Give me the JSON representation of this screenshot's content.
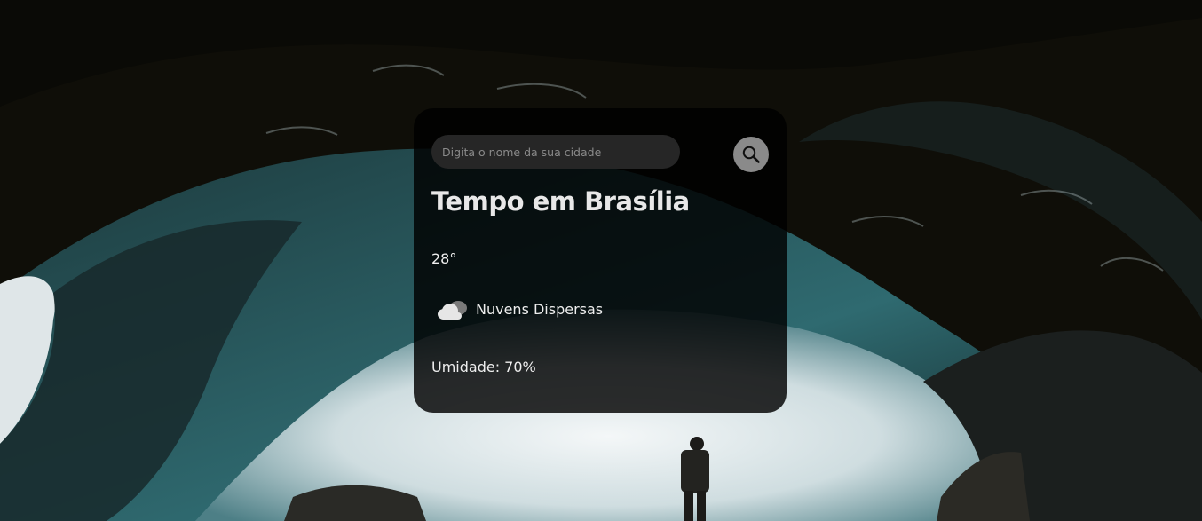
{
  "search": {
    "placeholder": "Digita o nome da sua cidade",
    "value": "",
    "button_icon": "search-icon"
  },
  "weather": {
    "title": "Tempo em Brasília",
    "temperature": "28°",
    "condition_icon": "cloud-icon",
    "condition": "Nuvens Dispersas",
    "humidity": "Umidade: 70%"
  },
  "colors": {
    "card_background": "#000000",
    "input_background": "#262626",
    "button_background": "#8a8a8a",
    "text": "#ffffff"
  }
}
